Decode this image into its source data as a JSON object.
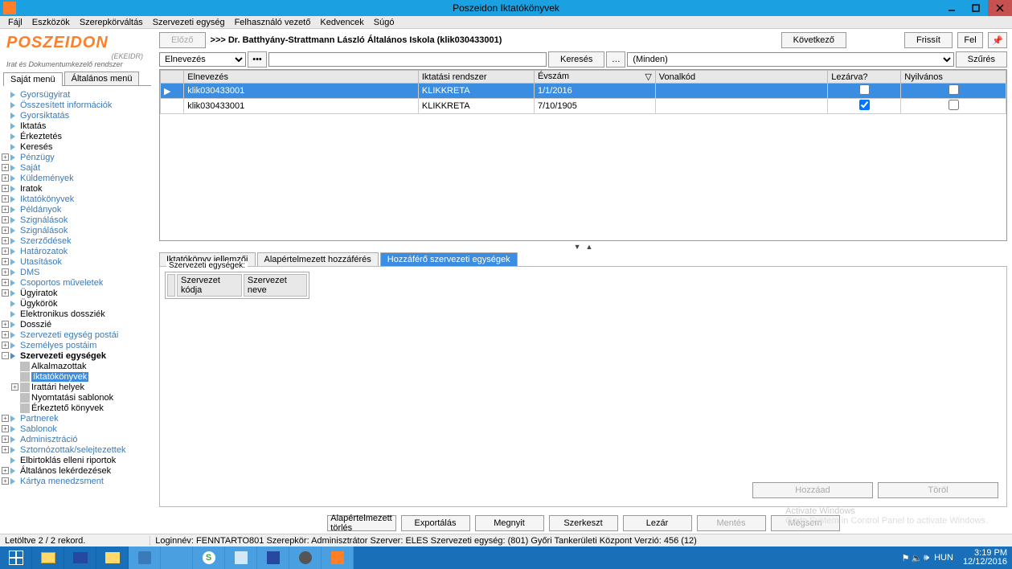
{
  "window_title": "Poszeidon Iktatókönyvek",
  "menu": [
    "Fájl",
    "Eszközök",
    "Szerepkörváltás",
    "Szervezeti egység",
    "Felhasználó vezető",
    "Kedvencek",
    "Súgó"
  ],
  "logo": {
    "brand": "POSZEIDON",
    "sub1": "(EKEIDR)",
    "sub2": "Irat és Dokumentumkezelő rendszer"
  },
  "left_tabs": [
    "Saját menü",
    "Általános menü"
  ],
  "tree": [
    {
      "t": "Gyorsügyirat",
      "cls": "link",
      "icon": "arrow"
    },
    {
      "t": "Összesített információk",
      "cls": "link",
      "icon": "arrow"
    },
    {
      "t": "Gyorsiktatás",
      "cls": "link",
      "icon": "arrow"
    },
    {
      "t": "Iktatás",
      "cls": "",
      "icon": "arrow"
    },
    {
      "t": "Érkeztetés",
      "cls": "",
      "icon": "arrow"
    },
    {
      "t": "Keresés",
      "cls": "",
      "icon": "arrow"
    },
    {
      "t": "Pénzügy",
      "cls": "link",
      "icon": "arrow",
      "exp": "+"
    },
    {
      "t": "Saját",
      "cls": "link",
      "icon": "arrow",
      "exp": "+"
    },
    {
      "t": "Küldemények",
      "cls": "link",
      "icon": "arrow",
      "exp": "+"
    },
    {
      "t": "Iratok",
      "cls": "",
      "icon": "arrow",
      "exp": "+"
    },
    {
      "t": "Iktatókönyvek",
      "cls": "link",
      "icon": "arrow",
      "exp": "+"
    },
    {
      "t": "Példányok",
      "cls": "link",
      "icon": "arrow",
      "exp": "+"
    },
    {
      "t": "Szignálások",
      "cls": "link",
      "icon": "arrow",
      "exp": "+"
    },
    {
      "t": "Szignálások",
      "cls": "link",
      "icon": "arrow",
      "exp": "+"
    },
    {
      "t": "Szerződések",
      "cls": "link",
      "icon": "arrow",
      "exp": "+"
    },
    {
      "t": "Határozatok",
      "cls": "link",
      "icon": "arrow",
      "exp": "+"
    },
    {
      "t": "Utasítások",
      "cls": "link",
      "icon": "arrow",
      "exp": "+"
    },
    {
      "t": "DMS",
      "cls": "link",
      "icon": "arrow",
      "exp": "+"
    },
    {
      "t": "Csoportos műveletek",
      "cls": "link",
      "icon": "arrow",
      "exp": "+"
    },
    {
      "t": "Ügyiratok",
      "cls": "",
      "icon": "arrow",
      "exp": "+"
    },
    {
      "t": "Ügykörök",
      "cls": "",
      "icon": "arrow"
    },
    {
      "t": "Elektronikus dossziék",
      "cls": "",
      "icon": "arrow"
    },
    {
      "t": "Dosszié",
      "cls": "",
      "icon": "arrow",
      "exp": "+"
    },
    {
      "t": "Szervezeti egység postái",
      "cls": "link",
      "icon": "arrow",
      "exp": "+"
    },
    {
      "t": "Személyes postáim",
      "cls": "link",
      "icon": "arrow",
      "exp": "+"
    },
    {
      "t": "Szervezeti egységek",
      "cls": "bold",
      "icon": "arrow2",
      "exp": "-"
    },
    {
      "t": "Alkalmazottak",
      "cls": "",
      "icon": "doc",
      "ind": "ind1"
    },
    {
      "t": "Iktatókönyvek",
      "cls": "sel",
      "icon": "doc",
      "ind": "ind1"
    },
    {
      "t": "Irattári helyek",
      "cls": "",
      "icon": "doc",
      "ind": "ind1",
      "exp": "+"
    },
    {
      "t": "Nyomtatási sablonok",
      "cls": "",
      "icon": "doc",
      "ind": "ind1"
    },
    {
      "t": "Érkeztető könyvek",
      "cls": "",
      "icon": "doc",
      "ind": "ind1"
    },
    {
      "t": "Partnerek",
      "cls": "link",
      "icon": "arrow",
      "exp": "+"
    },
    {
      "t": "Sablonok",
      "cls": "link",
      "icon": "arrow",
      "exp": "+"
    },
    {
      "t": "Adminisztráció",
      "cls": "link",
      "icon": "arrow",
      "exp": "+"
    },
    {
      "t": "Sztornózottak/selejtezettek",
      "cls": "link",
      "icon": "arrow",
      "exp": "+"
    },
    {
      "t": "Elbirtoklás elleni riportok",
      "cls": "",
      "icon": "arrow"
    },
    {
      "t": "Általános lekérdezések",
      "cls": "",
      "icon": "arrow",
      "exp": "+"
    },
    {
      "t": "Kártya menedzsment",
      "cls": "link",
      "icon": "arrow",
      "exp": "+"
    }
  ],
  "toprow": {
    "prev": "Előző",
    "breadcrumb": ">>> Dr. Batthyány-Strattmann László Általános Iskola (klik030433001)",
    "next": "Következő",
    "refresh": "Frissít",
    "up": "Fel"
  },
  "search": {
    "field": "Elnevezés",
    "button": "Keresés",
    "more": "…",
    "filter": "(Minden)",
    "filterbtn": "Szűrés"
  },
  "grid": {
    "headers": [
      "Elnevezés",
      "Iktatási rendszer",
      "Évszám",
      "Vonalkód",
      "Lezárva?",
      "Nyilvános"
    ],
    "rows": [
      {
        "sel": true,
        "c": [
          "klik030433001",
          "KLIKKRETA",
          "1/1/2016",
          ""
        ],
        "cb1": false,
        "cb2": false
      },
      {
        "sel": false,
        "c": [
          "klik030433001",
          "KLIKKRETA",
          "7/10/1905",
          ""
        ],
        "cb1": true,
        "cb2": false
      }
    ]
  },
  "btabs": [
    "Iktatókönyv jellemzői",
    "Alapértelmezett hozzáférés",
    "Hozzáférő szervezeti egységek"
  ],
  "bgroup": {
    "label": "Szervezeti egységek:",
    "cols": [
      "",
      "Szervezet kódja",
      "Szervezet neve"
    ]
  },
  "actions": {
    "add": "Hozzáad",
    "del": "Töröl"
  },
  "mainactions": [
    "Alapértelmezett törlés",
    "Exportálás",
    "Megnyit",
    "Szerkeszt",
    "Lezár",
    "Mentés",
    "Mégsem"
  ],
  "status": {
    "left": "Letöltve 2 / 2 rekord.",
    "right": "Loginnév: FENNTARTO801   Szerepkör: Adminisztrátor   Szerver: ELES   Szervezeti egység: (801) Győri Tankerületi Központ   Verzió: 456 (12)"
  },
  "watermark": {
    "title": "Activate Windows",
    "sub": "Go to System in Control Panel to activate Windows."
  },
  "tray": {
    "lang": "HUN",
    "time": "3:19 PM",
    "date": "12/12/2016"
  }
}
